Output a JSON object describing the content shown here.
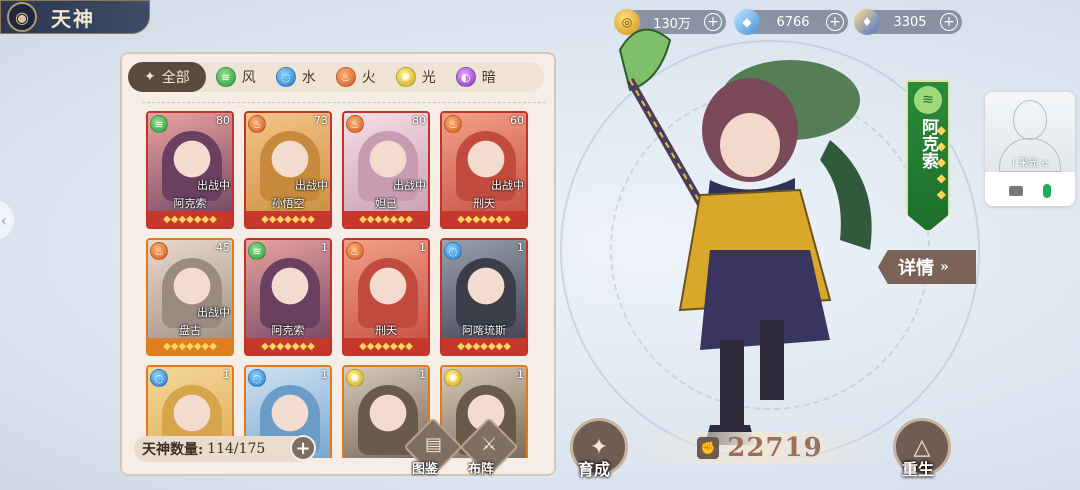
{
  "title": "天神",
  "resources": [
    {
      "icon": "gold-coin-icon",
      "value": "130万"
    },
    {
      "icon": "crystal-icon",
      "value": "6766"
    },
    {
      "icon": "potion-icon",
      "value": "3305"
    }
  ],
  "filters": [
    {
      "label": "全部",
      "element": "all",
      "active": true
    },
    {
      "label": "风",
      "element": "wind",
      "active": false
    },
    {
      "label": "水",
      "element": "water",
      "active": false
    },
    {
      "label": "火",
      "element": "fire",
      "active": false
    },
    {
      "label": "光",
      "element": "light",
      "active": false
    },
    {
      "label": "暗",
      "element": "dark",
      "active": false
    }
  ],
  "cards": [
    {
      "name": "阿克索",
      "level": "80",
      "status": "出战中",
      "element": "wind",
      "rarity": "red"
    },
    {
      "name": "孙悟空",
      "level": "73",
      "status": "出战中",
      "element": "fire",
      "rarity": "red"
    },
    {
      "name": "妲己",
      "level": "80",
      "status": "出战中",
      "element": "fire",
      "rarity": "red"
    },
    {
      "name": "刑天",
      "level": "60",
      "status": "出战中",
      "element": "fire",
      "rarity": "red"
    },
    {
      "name": "盘古",
      "level": "45",
      "status": "出战中",
      "element": "fire",
      "rarity": "orange"
    },
    {
      "name": "阿克索",
      "level": "1",
      "status": "",
      "element": "wind",
      "rarity": "red"
    },
    {
      "name": "刑天",
      "level": "1",
      "status": "",
      "element": "fire",
      "rarity": "red"
    },
    {
      "name": "阿喀琉斯",
      "level": "1",
      "status": "",
      "element": "water",
      "rarity": "red"
    },
    {
      "name": "",
      "level": "1",
      "status": "",
      "element": "water",
      "rarity": "orange"
    },
    {
      "name": "",
      "level": "1",
      "status": "",
      "element": "water",
      "rarity": "orange"
    },
    {
      "name": "",
      "level": "1",
      "status": "",
      "element": "light",
      "rarity": "orange"
    },
    {
      "name": "",
      "level": "1",
      "status": "",
      "element": "light",
      "rarity": "orange"
    }
  ],
  "count": {
    "label": "天神数量:",
    "value": "114/175"
  },
  "buttons": {
    "codex": "图鉴",
    "formation": "布阵",
    "develop": "育成",
    "rebirth": "重生",
    "detail": "详情"
  },
  "hero": {
    "name": "阿克索",
    "power": "22719"
  },
  "call": {
    "username": "I 采光 e"
  },
  "colors": {
    "panel": "#f6eee6",
    "accent_brown": "#6f5d53",
    "banner_green": "#2c8a3a"
  }
}
